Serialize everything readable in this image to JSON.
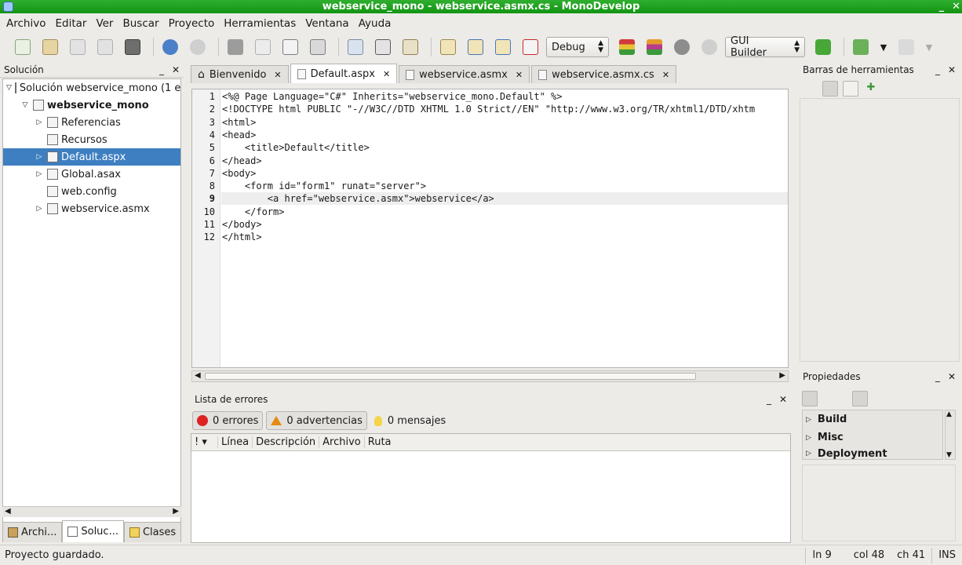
{
  "window": {
    "title": "webservice_mono - webservice.asmx.cs - MonoDevelop"
  },
  "menu": [
    "Archivo",
    "Editar",
    "Ver",
    "Buscar",
    "Proyecto",
    "Herramientas",
    "Ventana",
    "Ayuda"
  ],
  "toolbar": {
    "config": "Debug",
    "builder": "GUI Builder"
  },
  "solution_panel": {
    "title": "Solución",
    "items": [
      {
        "label": "Solución webservice_mono (1 e",
        "indent": 0,
        "expander": "▽",
        "icon": "solution-icon"
      },
      {
        "label": "webservice_mono",
        "indent": 1,
        "expander": "▽",
        "icon": "project-icon"
      },
      {
        "label": "Referencias",
        "indent": 2,
        "expander": "▷",
        "icon": "references-icon"
      },
      {
        "label": "Recursos",
        "indent": 2,
        "expander": "",
        "icon": "folder-icon"
      },
      {
        "label": "Default.aspx",
        "indent": 2,
        "expander": "▷",
        "icon": "aspx-file-icon"
      },
      {
        "label": "Global.asax",
        "indent": 2,
        "expander": "▷",
        "icon": "asax-file-icon"
      },
      {
        "label": "web.config",
        "indent": 2,
        "expander": "",
        "icon": "config-file-icon"
      },
      {
        "label": "webservice.asmx",
        "indent": 2,
        "expander": "▷",
        "icon": "asmx-file-icon"
      }
    ],
    "bottom_tabs": [
      "Archi...",
      "Soluc...",
      "Clases"
    ]
  },
  "editor": {
    "tabs": [
      "Bienvenido",
      "Default.aspx",
      "webservice.asmx",
      "webservice.asmx.cs"
    ],
    "active_tab": 1,
    "lines": [
      "<%@ Page Language=\"C#\" Inherits=\"webservice_mono.Default\" %>",
      "<!DOCTYPE html PUBLIC \"-//W3C//DTD XHTML 1.0 Strict//EN\" \"http://www.w3.org/TR/xhtml1/DTD/xhtm",
      "<html>",
      "<head>",
      "    <title>Default</title>",
      "</head>",
      "<body>",
      "    <form id=\"form1\" runat=\"server\">",
      "        <a href=\"webservice.asmx\">webservice</a>",
      "    </form>",
      "</body>",
      "</html>"
    ],
    "current_line": 9
  },
  "errors_panel": {
    "title": "Lista de errores",
    "errors": "0 errores",
    "warnings": "0 advertencias",
    "messages": "0 mensajes",
    "columns": [
      "! ▾",
      "Línea",
      "Descripción",
      "Archivo",
      "Ruta"
    ]
  },
  "toolbox_panel": {
    "title": "Barras de herramientas"
  },
  "properties_panel": {
    "title": "Propiedades",
    "groups": [
      "Build",
      "Misc",
      "Deployment"
    ]
  },
  "status": {
    "message": "Proyecto guardado.",
    "line": "ln 9",
    "col": "col 48",
    "ch": "ch 41",
    "mode": "INS"
  }
}
